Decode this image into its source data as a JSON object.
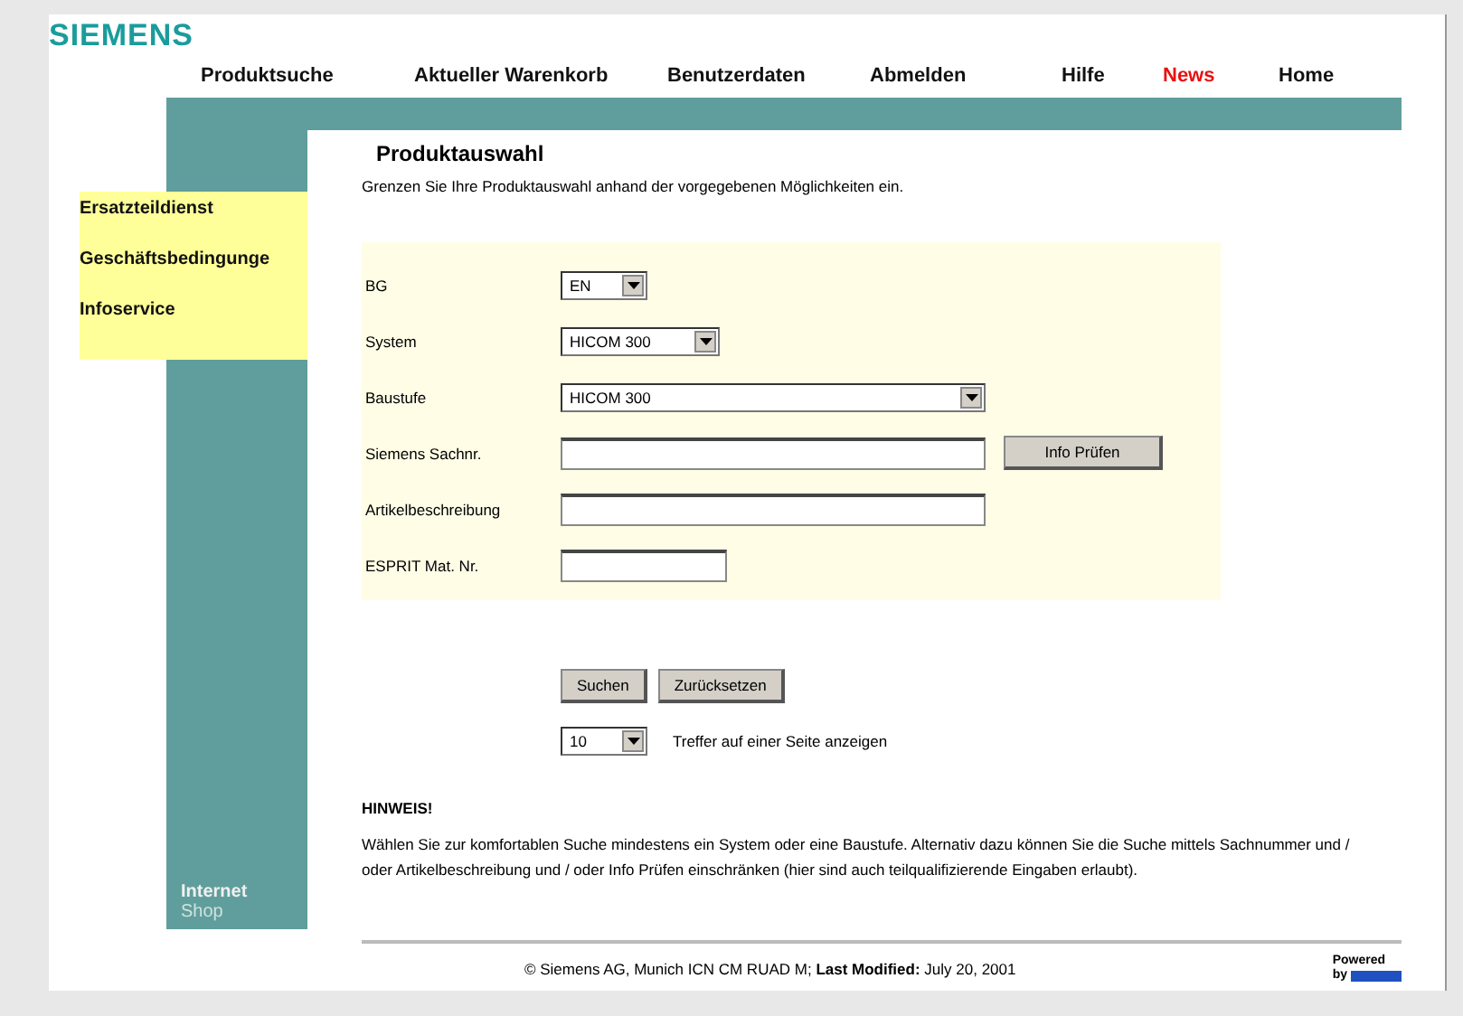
{
  "logo": "SIEMENS",
  "nav": [
    {
      "label": "Produktsuche",
      "selected": false
    },
    {
      "label": "Aktueller Warenkorb",
      "selected": false
    },
    {
      "label": "Benutzerdaten",
      "selected": false
    },
    {
      "label": "Abmelden",
      "selected": false
    },
    {
      "label": "Hilfe",
      "selected": false
    },
    {
      "label": "News",
      "selected": true
    },
    {
      "label": "Home",
      "selected": false
    }
  ],
  "side_menu": [
    "Ersatzteildienst",
    "Geschäftsbedingunge",
    "Infoservice"
  ],
  "sidebar_caption": {
    "line1": "Internet",
    "line2": "Shop"
  },
  "title": "Produktauswahl",
  "intro": "Grenzen Sie Ihre Produktauswahl anhand der vorgegebenen Möglichkeiten ein.",
  "form": [
    {
      "kind": "select",
      "label": "BG",
      "value": "EN"
    },
    {
      "kind": "select",
      "label": "System",
      "value": "HICOM 300"
    },
    {
      "kind": "select",
      "label": "Baustufe",
      "value": "HICOM 300"
    },
    {
      "kind": "input",
      "label": "Siemens Sachnr.",
      "button": "Info Prüfen"
    },
    {
      "kind": "input",
      "label": "Artikelbeschreibung"
    },
    {
      "kind": "input",
      "label": "ESPRIT Mat. Nr."
    }
  ],
  "buttons": [
    "Suchen",
    "Zurücksetzen"
  ],
  "per_page": {
    "value": "10",
    "label": "Treffer auf einer Seite anzeigen"
  },
  "hint_title": "HINWEIS!",
  "hint": "Wählen Sie zur komfortablen Suche mindestens ein System oder eine Baustufe. Alternativ dazu können Sie die Suche mittels Sachnummer und / oder Artikelbeschreibung und / oder Info Prüfen einschränken (hier sind auch teilqualifizierende Eingaben erlaubt).",
  "footer": "© Siemens AG, Munich ICN CM RUAD M; **Last Modified:** July 20, 2001",
  "powered": {
    "line1": "Powered",
    "line2": "by"
  }
}
